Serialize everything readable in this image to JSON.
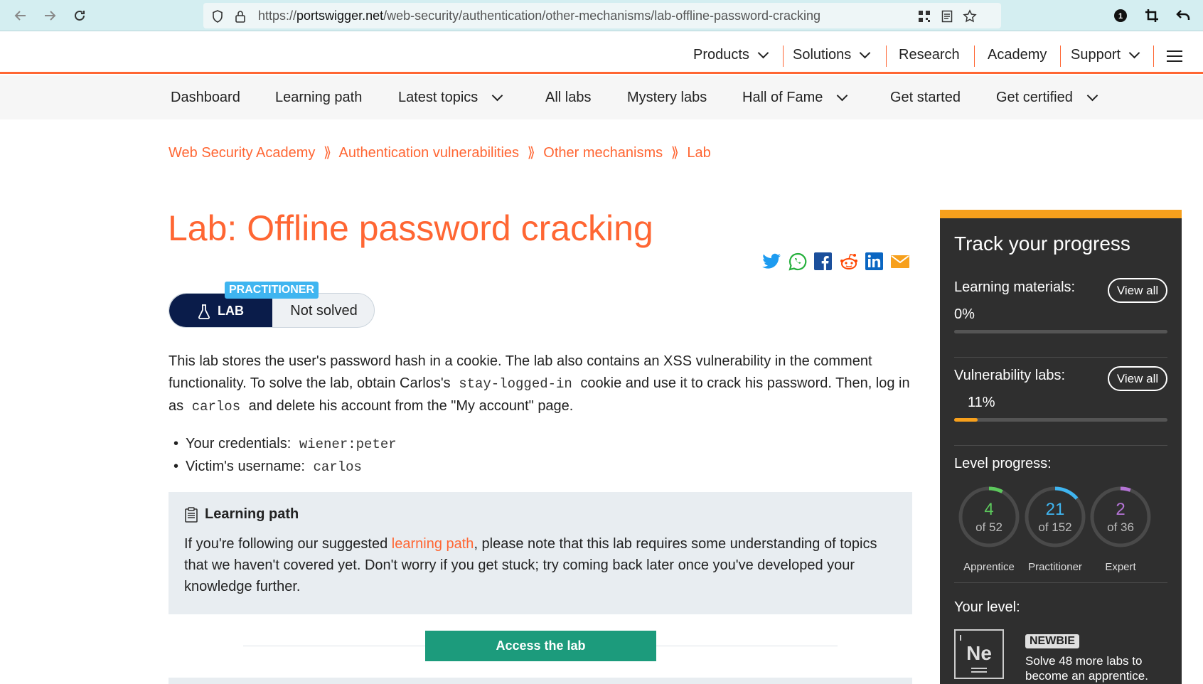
{
  "browser": {
    "url_host": "portswigger.net",
    "url_prefix": "https://",
    "url_path": "/web-security/authentication/other-mechanisms/lab-offline-password-cracking"
  },
  "top_nav": {
    "products": "Products",
    "solutions": "Solutions",
    "research": "Research",
    "academy": "Academy",
    "support": "Support"
  },
  "sub_nav": {
    "dashboard": "Dashboard",
    "learning_path": "Learning path",
    "latest_topics": "Latest topics",
    "all_labs": "All labs",
    "mystery_labs": "Mystery labs",
    "hall_of_fame": "Hall of Fame",
    "get_started": "Get started",
    "get_certified": "Get certified"
  },
  "breadcrumb": {
    "item1": "Web Security Academy",
    "item2": "Authentication vulnerabilities",
    "item3": "Other mechanisms",
    "item4": "Lab",
    "sep": "⟫"
  },
  "page": {
    "title": "Lab: Offline password cracking",
    "level_tag": "PRACTITIONER",
    "lab_label": "LAB",
    "status": "Not solved"
  },
  "description": {
    "part1": "This lab stores the user's password hash in a cookie. The lab also contains an XSS vulnerability in the comment functionality. To solve the lab, obtain Carlos's",
    "code1": "stay-logged-in",
    "part2": "cookie and use it to crack his password. Then, log in as",
    "code2": "carlos",
    "part3": "and delete his account from the \"My account\" page."
  },
  "credentials": {
    "label1": "Your credentials:",
    "value1": "wiener:peter",
    "label2": "Victim's username:",
    "value2": "carlos"
  },
  "learning_path_box": {
    "heading": "Learning path",
    "text1": "If you're following our suggested",
    "link": "learning path",
    "text2": ", please note that this lab requires some understanding of topics that we haven't covered yet. Don't worry if you get stuck; try coming back later once you've developed your knowledge further."
  },
  "access_button": "Access the lab",
  "progress": {
    "title": "Track your progress",
    "learning_materials_label": "Learning materials:",
    "learning_materials_pct": "0%",
    "learning_materials_value": 0,
    "view_all": "View all",
    "vuln_labs_label": "Vulnerability labs:",
    "vuln_labs_pct": "11%",
    "vuln_labs_value": 11,
    "level_progress_label": "Level progress:",
    "rings": [
      {
        "done": "4",
        "of": "of 52",
        "caption": "Apprentice",
        "color": "#5cc85c",
        "fraction": 0.077
      },
      {
        "done": "21",
        "of": "of 152",
        "caption": "Practitioner",
        "color": "#3fb5f0",
        "fraction": 0.138
      },
      {
        "done": "2",
        "of": "of 36",
        "caption": "Expert",
        "color": "#b574d6",
        "fraction": 0.056
      }
    ],
    "your_level_label": "Your level:",
    "element_symbol": "Ne",
    "level_badge": "NEWBIE",
    "level_text": "Solve 48 more labs to become an apprentice."
  },
  "colors": {
    "accent": "#ff6633",
    "lab_navy": "#0a1c4a",
    "practitioner_blue": "#3fb5f0",
    "access_green": "#1c9b7c",
    "panel_bg": "#2f2f2f",
    "panel_accent": "#f7a01c"
  }
}
